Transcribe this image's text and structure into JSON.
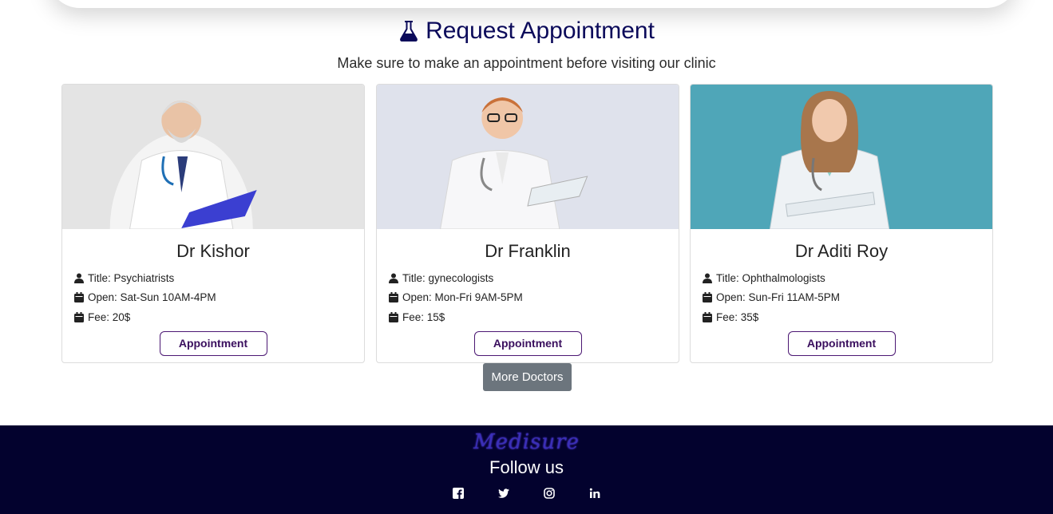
{
  "heading": {
    "title": "Request Appointment",
    "subtitle": "Make sure to make an appointment before visiting our clinic",
    "title_color": "#0b0a5a"
  },
  "doctors": [
    {
      "name": "Dr Kishor",
      "title": "Title: Psychiatrists",
      "open": "Open: Sat-Sun 10AM-4PM",
      "fee": "Fee: 20$",
      "button": "Appointment"
    },
    {
      "name": "Dr Franklin",
      "title": "Title: gynecologists",
      "open": "Open: Mon-Fri 9AM-5PM",
      "fee": "Fee: 15$",
      "button": "Appointment"
    },
    {
      "name": "Dr Aditi Roy",
      "title": "Title: Ophthalmologists",
      "open": "Open: Sun-Fri 11AM-5PM",
      "fee": "Fee: 35$",
      "button": "Appointment"
    }
  ],
  "more_button": "More Doctors",
  "footer": {
    "brand": "Medisure",
    "follow": "Follow us",
    "socials": [
      "facebook-icon",
      "twitter-icon",
      "instagram-icon",
      "linkedin-icon"
    ],
    "background": "#03022e"
  },
  "colors": {
    "button_border": "#4b1773",
    "more_button_bg": "#6c757d"
  }
}
